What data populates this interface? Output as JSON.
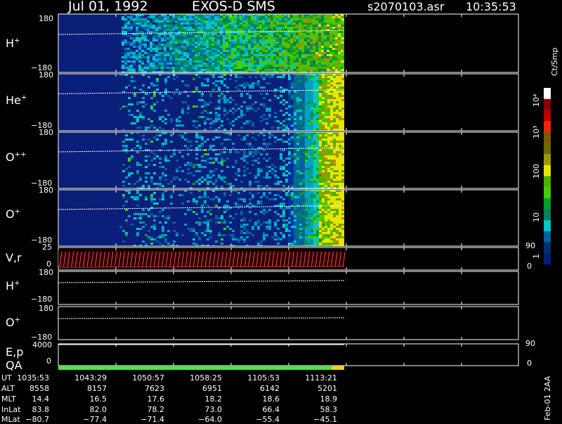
{
  "header": {
    "date": "Jul 01, 1992",
    "instrument": "EXOS-D SMS",
    "file": "s2070103.asr",
    "time": "10:35:53"
  },
  "panels": [
    {
      "name": "H",
      "sup": "+",
      "top_label": "180",
      "bottom_label": "−180"
    },
    {
      "name": "He",
      "sup": "+",
      "top_label": "180",
      "bottom_label": "−180"
    },
    {
      "name": "O",
      "sup": "++",
      "top_label": "180",
      "bottom_label": "−180"
    },
    {
      "name": "O",
      "sup": "+",
      "top_label": "180",
      "bottom_label": "−180"
    }
  ],
  "vr_panel": {
    "label": "V,r",
    "top_label": "25",
    "zero_label": "0",
    "right_top": "90",
    "right_bottom": "0"
  },
  "h_line_panel": {
    "name": "H",
    "sup": "+",
    "top_label": "180",
    "bottom_label": "−180"
  },
  "o_line_panel": {
    "name": "O",
    "sup": "+",
    "top_label": "180",
    "bottom_label": "−180"
  },
  "ep_panel": {
    "label": "E,p",
    "top_label": "4000",
    "zero_label": "0",
    "right_top": "90",
    "right_bottom": "0"
  },
  "qa_label": "QA",
  "colorbar": {
    "unit": "Ct/Smp",
    "labels": [
      "10⁴",
      "10³",
      "100",
      "10",
      "1"
    ],
    "colors": [
      "#ffffff",
      "#8b0000",
      "#c00000",
      "#ff2000",
      "#7a5a00",
      "#6b6b00",
      "#9a9a00",
      "#e6e600",
      "#4cb000",
      "#3fd000",
      "#00a030",
      "#008060",
      "#00c8c8",
      "#0060a0",
      "#003070",
      "#001a80"
    ]
  },
  "footer": {
    "rows": [
      {
        "label": "UT",
        "values": [
          "1035:53",
          "1043:29",
          "1050:57",
          "1058:25",
          "1105:53",
          "1113:21"
        ]
      },
      {
        "label": "ALT",
        "values": [
          "8558",
          "8157",
          "7623",
          "6951",
          "6142",
          "5201"
        ]
      },
      {
        "label": "MLT",
        "values": [
          "14.4",
          "16.5",
          "17.6",
          "18.2",
          "18.6",
          "18.9"
        ]
      },
      {
        "label": "InLat",
        "values": [
          "83.8",
          "82.0",
          "78.2",
          "73.0",
          "66.4",
          "58.3"
        ]
      },
      {
        "label": "MLat",
        "values": [
          "−80.7",
          "−77.4",
          "−71.4",
          "−64.0",
          "−55.4",
          "−45.1"
        ]
      }
    ],
    "side_note": "Feb-01 2AA"
  },
  "chart_data": {
    "type": "heatmap",
    "title": "Jul 01, 1992  EXOS-D SMS",
    "x": [
      "1035:53",
      "1043:29",
      "1050:57",
      "1058:25",
      "1105:53",
      "1113:21"
    ],
    "ylim": [
      -180,
      180
    ],
    "series": [
      {
        "name": "H+",
        "data_start": "1035:53",
        "data_end": "1113:21"
      },
      {
        "name": "He+"
      },
      {
        "name": "O++"
      },
      {
        "name": "O+"
      }
    ],
    "colorbar_range": [
      1,
      10000
    ],
    "colorbar_unit": "Ct/Smp"
  }
}
